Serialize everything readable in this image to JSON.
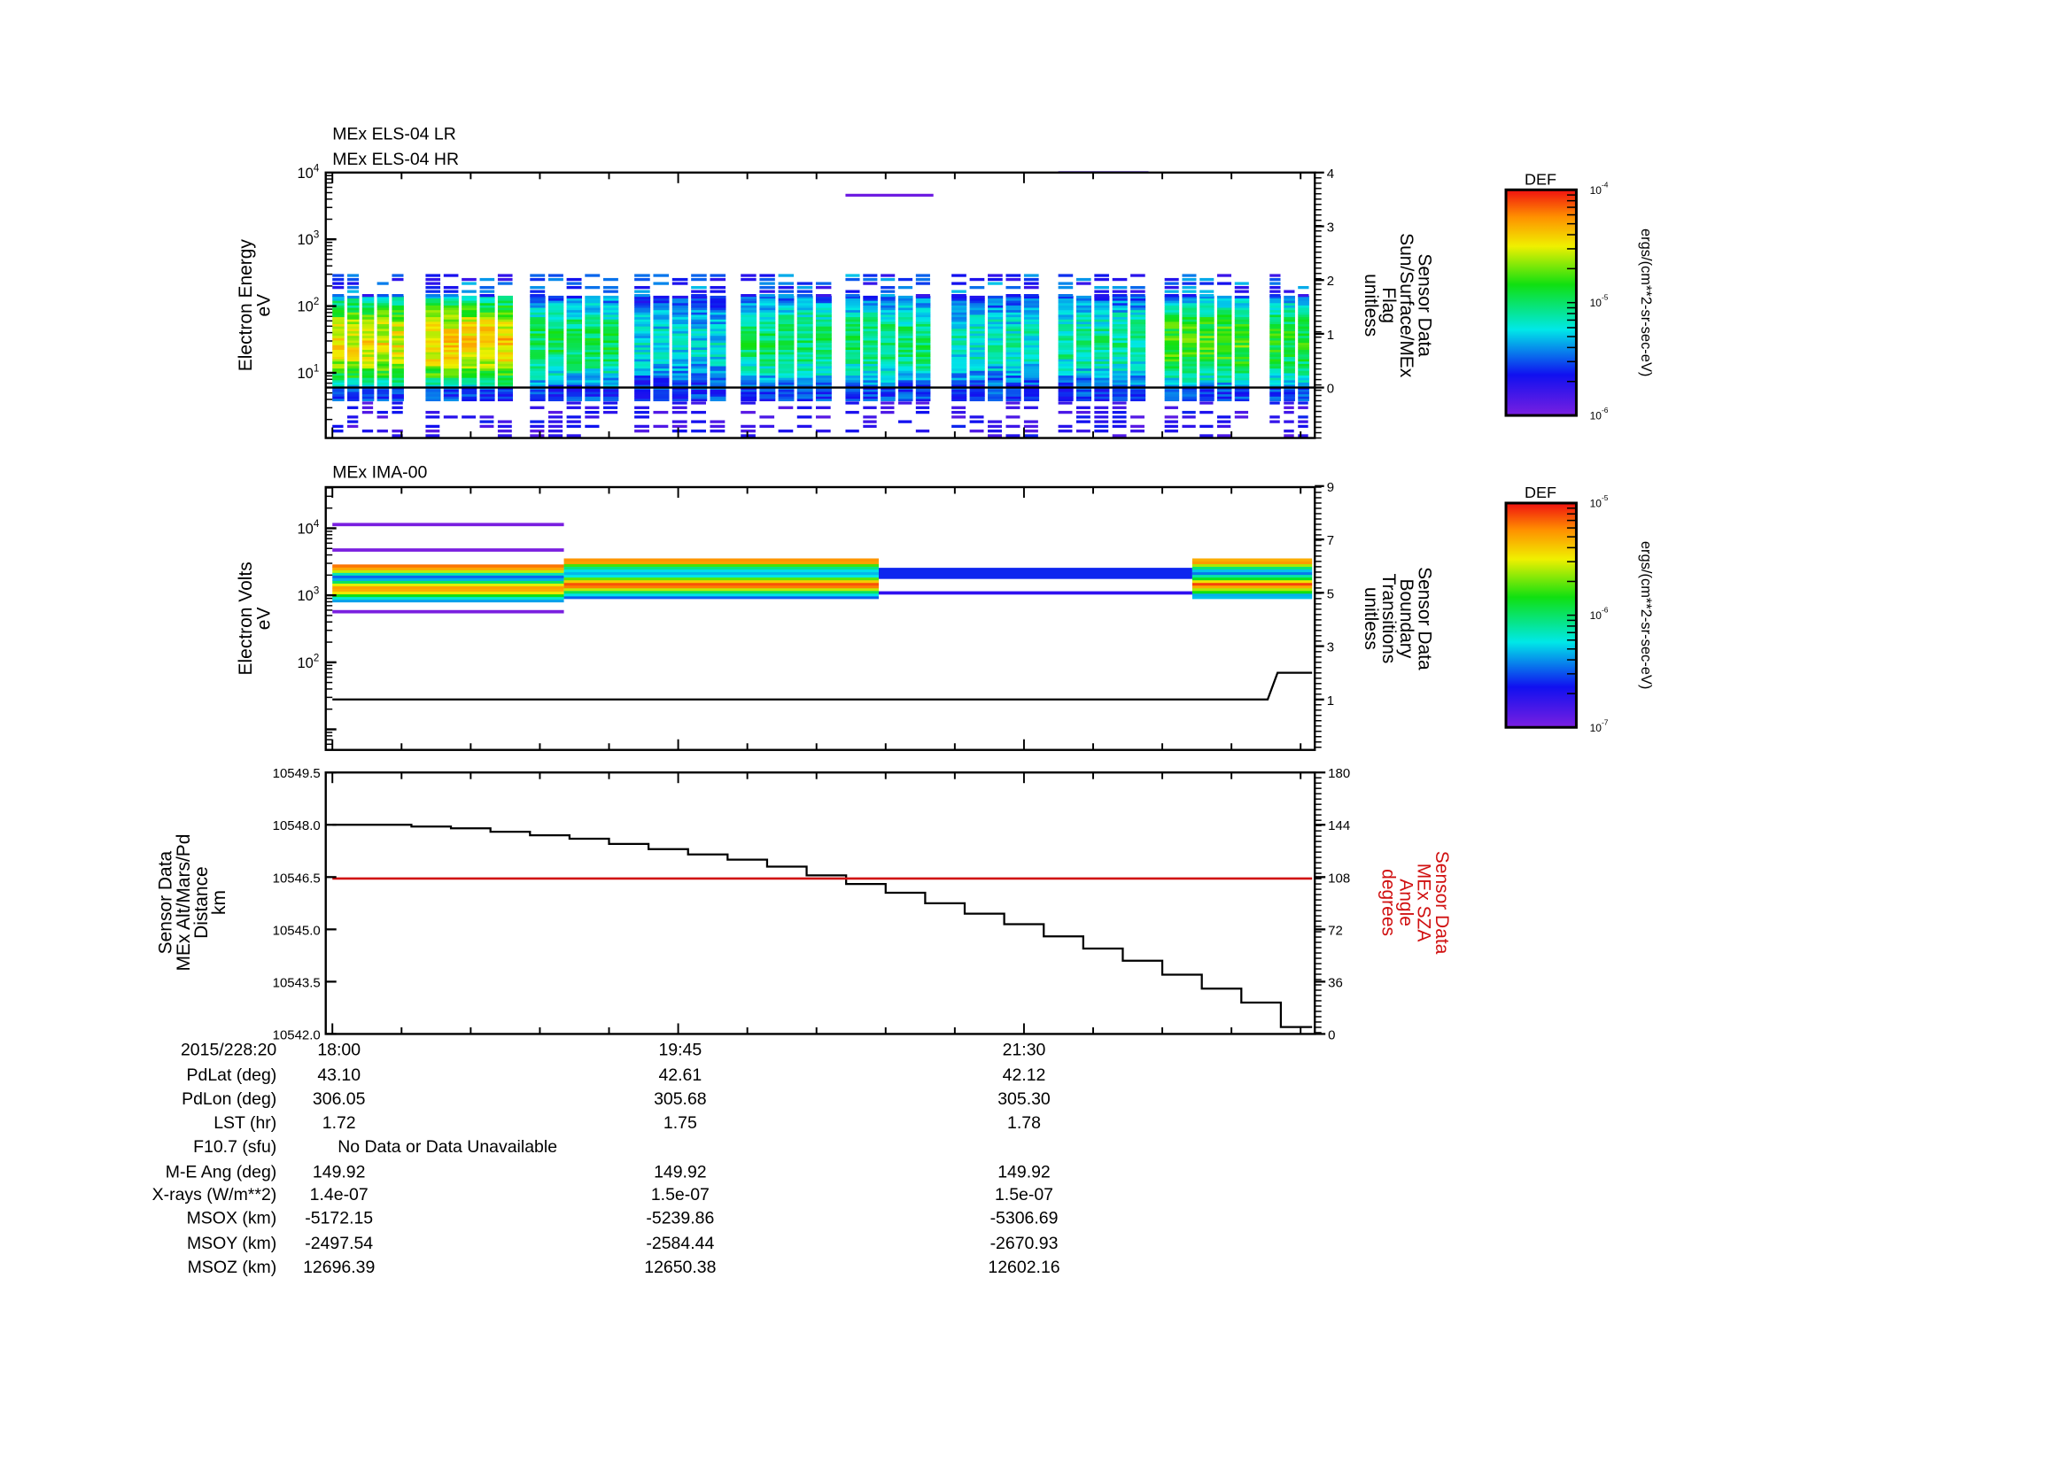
{
  "chart_data": [
    {
      "type": "heatmap",
      "titles": [
        "MEx ELS-04 LR",
        "MEx ELS-04 HR"
      ],
      "ylabel": [
        "Electron Energy",
        "eV"
      ],
      "yscale": "log",
      "ylim_log10": [
        0,
        4
      ],
      "yticks": [
        {
          "base": "10",
          "exp": "1",
          "v": 1
        },
        {
          "base": "10",
          "exp": "2",
          "v": 2
        },
        {
          "base": "10",
          "exp": "3",
          "v": 3
        },
        {
          "base": "10",
          "exp": "4",
          "v": 4
        }
      ],
      "y2label": [
        "Sensor Data",
        "Sun/Surface/MEx",
        "Flag",
        "unitless"
      ],
      "y2lim": [
        -0.94,
        4
      ],
      "y2ticks": [
        "0",
        "1",
        "2",
        "3",
        "4"
      ],
      "flag_series": {
        "name": "Sun/Surface/MEx Flag",
        "value": 0
      },
      "segments_minutes_from_1800": [
        [
          0,
          22.6
        ],
        [
          28.3,
          55.7
        ],
        [
          60,
          87.8
        ],
        [
          91.7,
          120.4
        ],
        [
          124,
          152.5
        ],
        [
          155.8,
          182.5
        ],
        [
          188,
          215.5
        ],
        [
          220.4,
          247.8
        ],
        [
          252.7,
          279.3
        ],
        [
          284.6,
          297.5
        ]
      ],
      "segment_peak_level": [
        0.76,
        0.8,
        0.52,
        0.38,
        0.5,
        0.5,
        0.42,
        0.46,
        0.62,
        0.56
      ],
      "colorbar": {
        "title": "DEF",
        "units": "ergs/(cm**2-sr-sec-eV)",
        "min": {
          "base": "10",
          "exp": "-6"
        },
        "mid": {
          "base": "10",
          "exp": "-5"
        },
        "max": {
          "base": "10",
          "exp": "-4"
        }
      }
    },
    {
      "type": "heatmap",
      "titles": [
        "MEx IMA-00"
      ],
      "ylabel": [
        "Electron Volts",
        "eV"
      ],
      "yscale": "log",
      "ylim_log10": [
        0.4,
        4.6
      ],
      "yticks": [
        {
          "base": "10",
          "exp": "2",
          "v": 2
        },
        {
          "base": "10",
          "exp": "3",
          "v": 3
        },
        {
          "base": "10",
          "exp": "4",
          "v": 4
        }
      ],
      "y2label": [
        "Sensor Data",
        "Boundary",
        "Transitions",
        "unitless"
      ],
      "y2lim": [
        -0.9,
        9
      ],
      "y2ticks": [
        "1",
        "3",
        "5",
        "7",
        "9"
      ],
      "boundary_series": {
        "x_minutes": [
          0,
          284,
          287,
          297.5
        ],
        "y": [
          1,
          1,
          2,
          2
        ]
      },
      "segments_minutes_from_1800": [
        [
          0,
          70.3
        ],
        [
          70.3,
          165.9
        ],
        [
          165.9,
          261.1
        ],
        [
          261.1,
          297.5
        ]
      ],
      "segment_bands_log10": [
        [
          2.9,
          3.45
        ],
        [
          2.95,
          3.55
        ],
        [
          3.25,
          3.4
        ],
        [
          2.95,
          3.55
        ]
      ],
      "colorbar": {
        "title": "DEF",
        "units": "ergs/(cm**2-sr-sec-eV)",
        "min": {
          "base": "10",
          "exp": "-7"
        },
        "mid": {
          "base": "10",
          "exp": "-6"
        },
        "max": {
          "base": "10",
          "exp": "-5"
        }
      }
    },
    {
      "type": "line",
      "ylabel": [
        "Sensor Data",
        "MEx Alt/Mars/Pd",
        "Distance",
        "km"
      ],
      "ylim": [
        10542.0,
        10549.5
      ],
      "yticks": [
        "10542.0",
        "10543.5",
        "10545.0",
        "10546.5",
        "10548.0",
        "10549.5"
      ],
      "y2label": [
        "Sensor Data",
        "MEx SZA",
        "Angle",
        "degrees"
      ],
      "y2lim": [
        0,
        180
      ],
      "y2ticks": [
        "0",
        "36",
        "72",
        "108",
        "144",
        "180"
      ],
      "series": [
        {
          "name": "MEx Alt/Mars/Pd Distance (km)",
          "color": "#000000",
          "x_minutes": [
            0,
            12,
            24,
            36,
            48,
            60,
            72,
            84,
            96,
            108,
            120,
            132,
            144,
            156,
            168,
            180,
            192,
            204,
            216,
            228,
            240,
            252,
            264,
            276,
            288,
            297.5
          ],
          "y": [
            10548.0,
            10548.0,
            10547.95,
            10547.9,
            10547.8,
            10547.7,
            10547.6,
            10547.45,
            10547.3,
            10547.15,
            10547.0,
            10546.8,
            10546.55,
            10546.3,
            10546.05,
            10545.75,
            10545.45,
            10545.15,
            10544.8,
            10544.45,
            10544.1,
            10543.7,
            10543.3,
            10542.9,
            10542.2,
            10542.2
          ]
        },
        {
          "name": "MEx SZA Angle (degrees)",
          "color": "#d01010",
          "x_minutes": [
            0,
            297.5
          ],
          "y": [
            107,
            107
          ]
        }
      ]
    }
  ],
  "xaxis": {
    "date_label": "2015/228:20",
    "ticks": [
      "18:00",
      "19:45",
      "21:30"
    ],
    "range_minutes": [
      0,
      297.5
    ]
  },
  "ephemeris": {
    "rows": [
      {
        "label": "PdLat (deg)",
        "values": [
          "43.10",
          "42.61",
          "42.12"
        ]
      },
      {
        "label": "PdLon (deg)",
        "values": [
          "306.05",
          "305.68",
          "305.30"
        ]
      },
      {
        "label": "LST (hr)",
        "values": [
          "1.72",
          "1.75",
          "1.78"
        ]
      },
      {
        "label": "F10.7 (sfu)",
        "note": "No Data or Data Unavailable"
      },
      {
        "label": "M-E Ang (deg)",
        "values": [
          "149.92",
          "149.92",
          "149.92"
        ]
      },
      {
        "label": "X-rays (W/m**2)",
        "values": [
          "1.4e-07",
          "1.5e-07",
          "1.5e-07"
        ]
      },
      {
        "label": "MSOX (km)",
        "values": [
          "-5172.15",
          "-5239.86",
          "-5306.69"
        ]
      },
      {
        "label": "MSOY (km)",
        "values": [
          "-2497.54",
          "-2584.44",
          "-2670.93"
        ]
      },
      {
        "label": "MSOZ (km)",
        "values": [
          "12696.39",
          "12650.38",
          "12602.16"
        ]
      }
    ]
  }
}
